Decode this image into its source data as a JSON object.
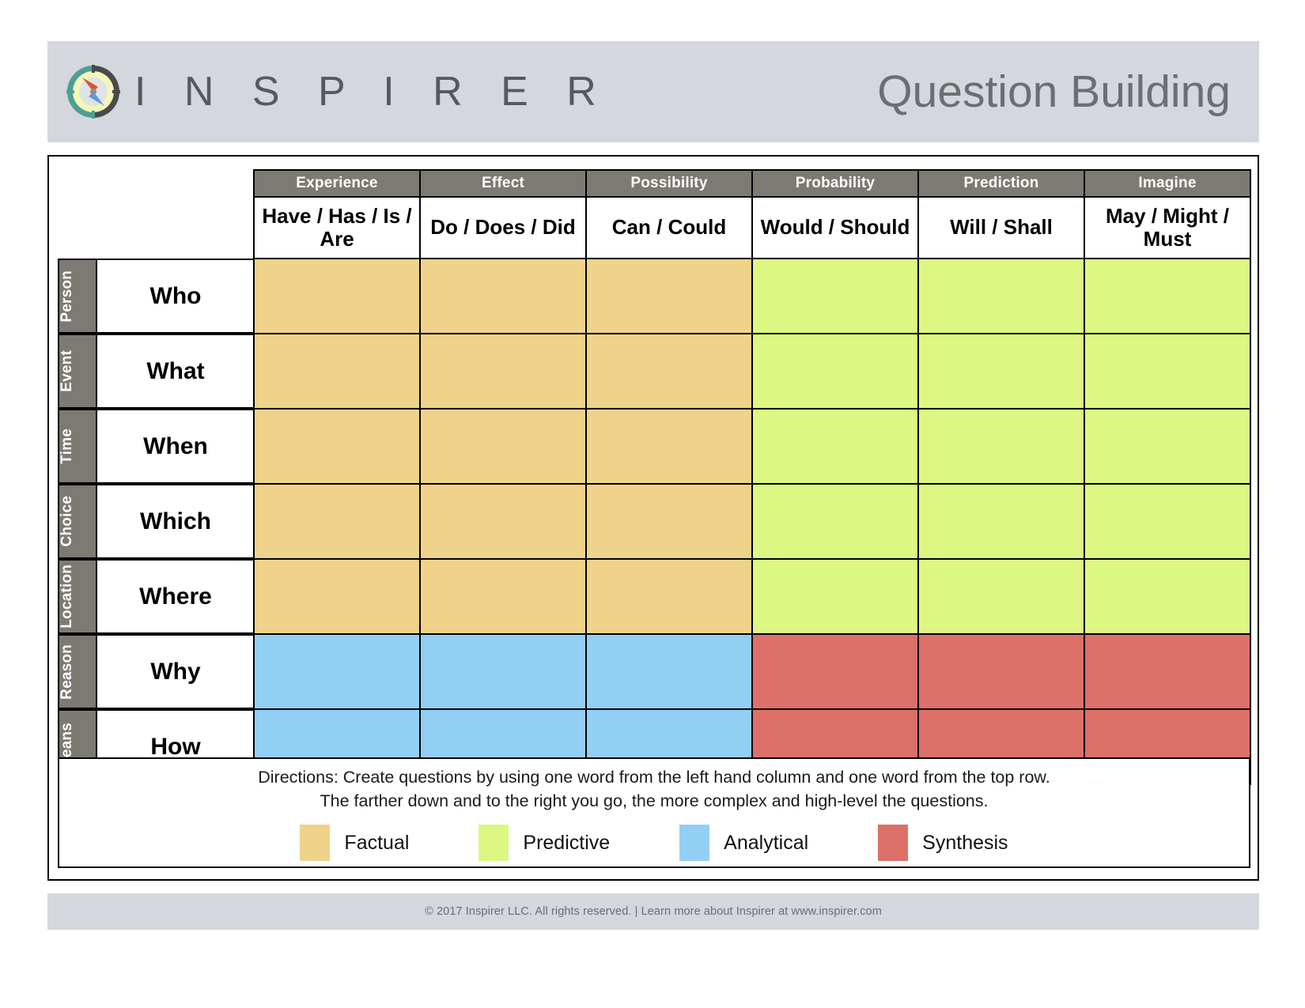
{
  "header": {
    "brand_name": "I N S P I R E R",
    "logo_icon": "compass-icon",
    "doc_title": "Question Building",
    "bar_color": "#d4d7de",
    "title_color": "#6d6e70"
  },
  "table": {
    "category_headers": [
      "Experience",
      "Effect",
      "Possibility",
      "Probability",
      "Prediction",
      "Imagine"
    ],
    "verb_headers": [
      "Have / Has / Is / Are",
      "Do / Does / Did",
      "Can / Could",
      "Would / Should",
      "Will / Shall",
      "May / Might / Must"
    ],
    "rows": [
      {
        "side_label": "Person",
        "question_word": "Who",
        "cells": [
          "factual",
          "factual",
          "factual",
          "predictive",
          "predictive",
          "predictive"
        ]
      },
      {
        "side_label": "Event",
        "question_word": "What",
        "cells": [
          "factual",
          "factual",
          "factual",
          "predictive",
          "predictive",
          "predictive"
        ]
      },
      {
        "side_label": "Time",
        "question_word": "When",
        "cells": [
          "factual",
          "factual",
          "factual",
          "predictive",
          "predictive",
          "predictive"
        ]
      },
      {
        "side_label": "Choice",
        "question_word": "Which",
        "cells": [
          "factual",
          "factual",
          "factual",
          "predictive",
          "predictive",
          "predictive"
        ]
      },
      {
        "side_label": "Location",
        "question_word": "Where",
        "cells": [
          "factual",
          "factual",
          "factual",
          "predictive",
          "predictive",
          "predictive"
        ]
      },
      {
        "side_label": "Reason",
        "question_word": "Why",
        "cells": [
          "analytical",
          "analytical",
          "analytical",
          "synthesis",
          "synthesis",
          "synthesis"
        ]
      },
      {
        "side_label": "Means",
        "question_word": "How",
        "cells": [
          "analytical",
          "analytical",
          "analytical",
          "synthesis",
          "synthesis",
          "synthesis"
        ]
      }
    ],
    "header_bg_color": "#7d7a74",
    "header_text_color": "#ffffff"
  },
  "directions": {
    "line1": "Directions: Create questions by using one word from the left hand column and one word from the top row.",
    "line2": "The farther down and to the right you go, the more complex and high-level the questions."
  },
  "legend": {
    "items": [
      {
        "label": "Factual",
        "color": "#f0d38a",
        "key": "factual"
      },
      {
        "label": "Predictive",
        "color": "#dcf882",
        "key": "predictive"
      },
      {
        "label": "Analytical",
        "color": "#93cff4",
        "key": "analytical"
      },
      {
        "label": "Synthesis",
        "color": "#dd7068",
        "key": "synthesis"
      }
    ]
  },
  "footer": {
    "text": "© 2017 Inspirer LLC. All rights reserved.  |  Learn more about Inspirer at www.inspirer.com",
    "bar_color": "#d4d7de"
  }
}
